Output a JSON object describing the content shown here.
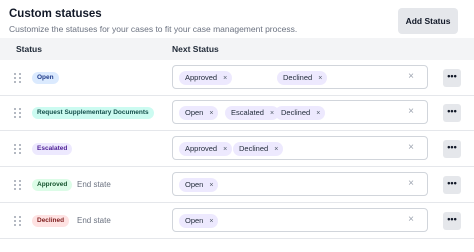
{
  "header": {
    "title": "Custom statuses",
    "subtitle": "Customize the statuses for your cases to fit your case management process.",
    "add_button": "Add Status"
  },
  "table": {
    "columns": [
      "Status",
      "Next Status"
    ],
    "rows": [
      {
        "status": "Open",
        "badge_bg": "#dbeafe",
        "badge_fg": "#1e3a8a",
        "end_state": "",
        "next": [
          "Approved",
          "Declined"
        ]
      },
      {
        "status": "Request Supplementary Documents",
        "badge_bg": "#ccfbf1",
        "badge_fg": "#134e4a",
        "end_state": "",
        "next": [
          "Open",
          "Escalated",
          "Declined"
        ]
      },
      {
        "status": "Escalated",
        "badge_bg": "#ede9fe",
        "badge_fg": "#4c1d95",
        "end_state": "",
        "next": [
          "Approved",
          "Declined"
        ]
      },
      {
        "status": "Approved",
        "badge_bg": "#dcfce7",
        "badge_fg": "#14532d",
        "end_state": "End state",
        "next": [
          "Open"
        ]
      },
      {
        "status": "Declined",
        "badge_bg": "#fee2e2",
        "badge_fg": "#7f1d1d",
        "end_state": "End state",
        "next": [
          "Open"
        ]
      }
    ]
  },
  "icons": {
    "remove": "×",
    "clear": "×",
    "more": "•••"
  }
}
